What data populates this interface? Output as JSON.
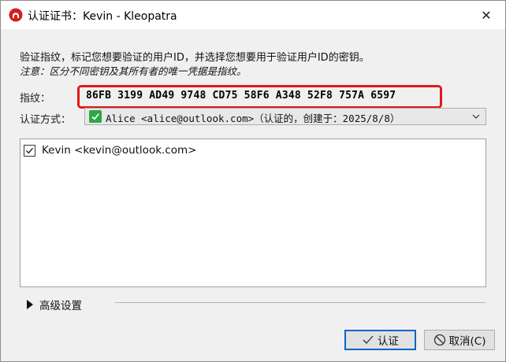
{
  "window": {
    "title": "认证证书：Kevin - Kleopatra",
    "close_symbol": "✕"
  },
  "dialog": {
    "description": "验证指纹，标记您想要验证的用户ID，并选择您想要用于验证用户ID的密钥。",
    "note": "注意：区分不同密钥及其所有者的唯一凭据是指纹。",
    "fingerprint_label": "指纹：",
    "fingerprint_value": "86FB 3199 AD49 9748 CD75 58F6 A348 52F8 757A 6597",
    "certify_with_label": "认证方式：",
    "certify_with_value": "Alice <alice@outlook.com>（认证的，创建于：2025/8/8）",
    "user_ids": [
      {
        "label": "Kevin <kevin@outlook.com>",
        "checked": true
      }
    ],
    "advanced_label": "高级设置"
  },
  "buttons": {
    "certify": "认证",
    "cancel": "取消(C)"
  },
  "colors": {
    "highlight_border": "#e0191a",
    "default_button_border": "#0a64c8",
    "valid_key_check": "#2aa845"
  },
  "icons": {
    "app": "kleopatra-icon",
    "close": "close-icon",
    "valid": "check-icon",
    "dropdown": "chevron-down-icon",
    "expand": "triangle-right-icon",
    "certify": "checkmark-icon",
    "cancel": "prohibited-icon"
  }
}
